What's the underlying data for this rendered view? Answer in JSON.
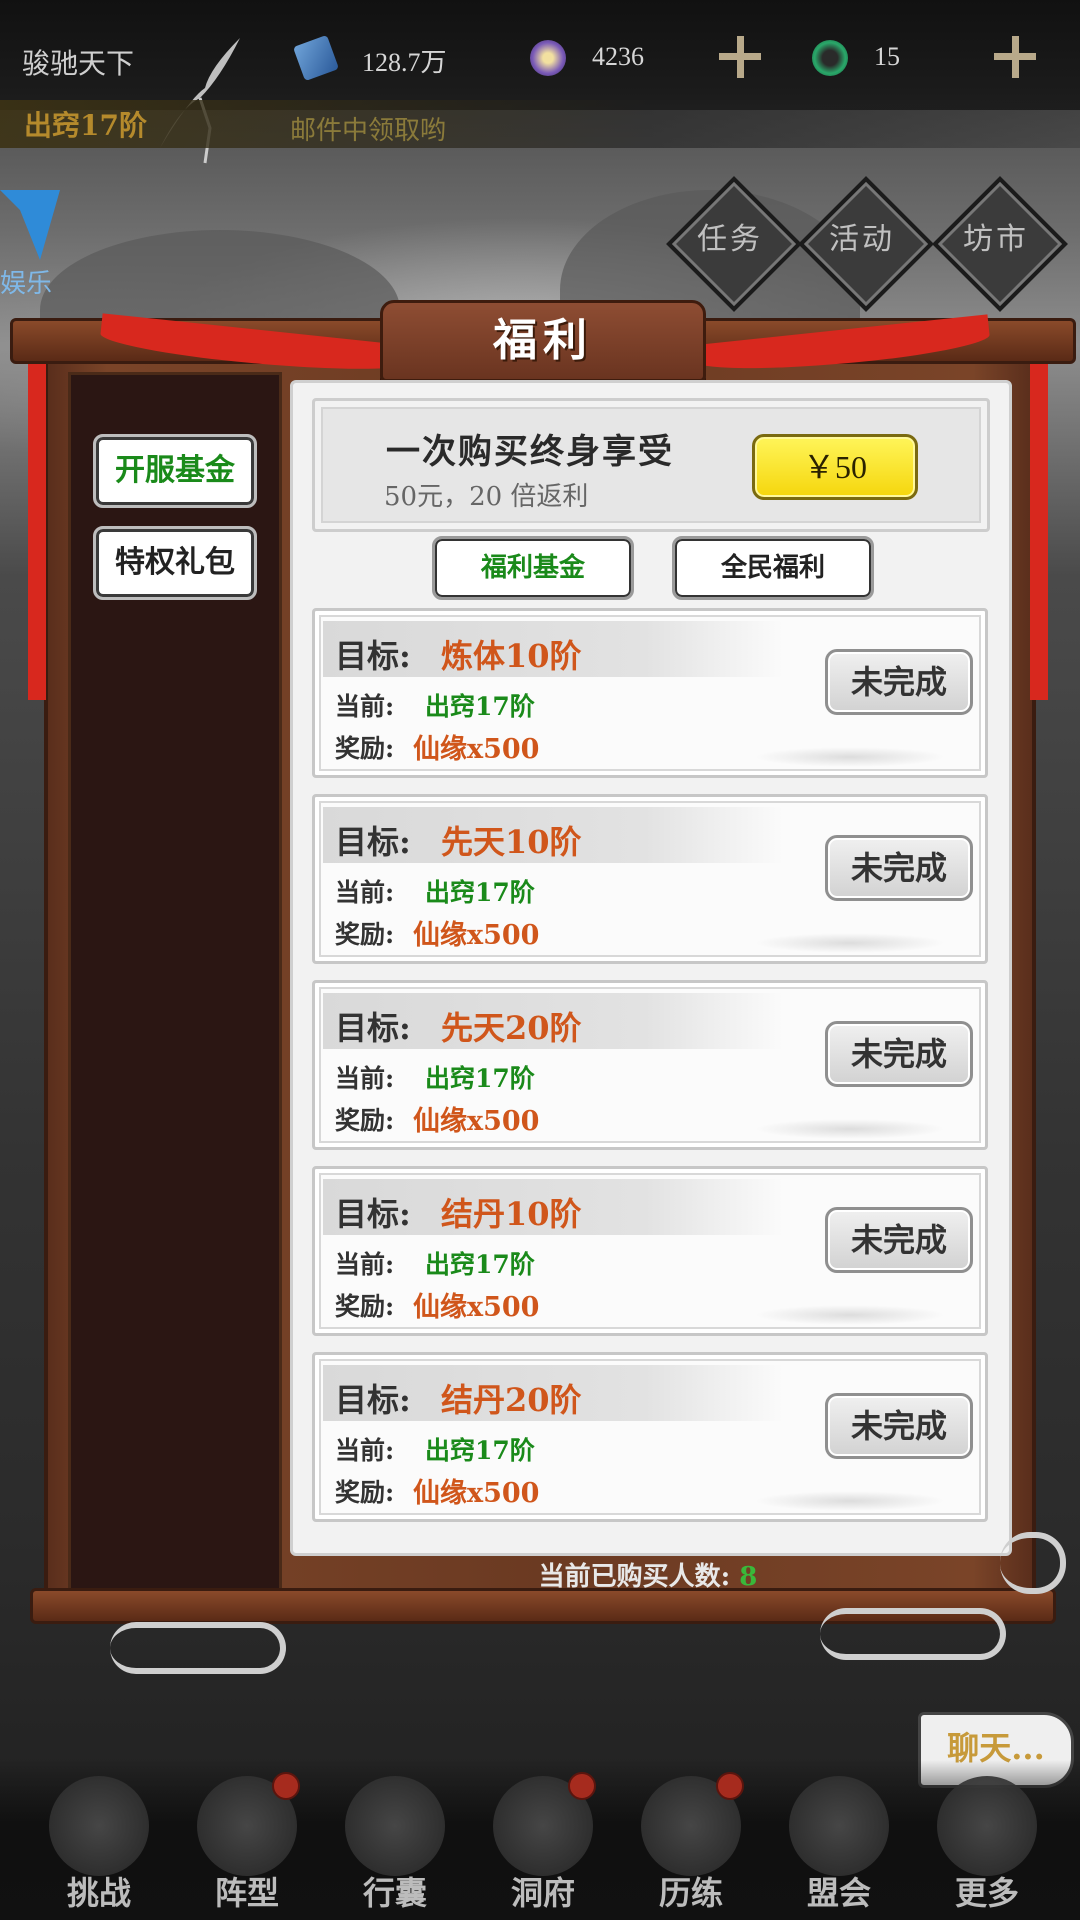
{
  "header": {
    "server_name": "骏驰天下",
    "resource_1": "128.7万",
    "resource_2": "4236",
    "resource_3": "15",
    "rank": "出窍17阶",
    "ticker": "邮件中领取哟"
  },
  "side_logo": "娱乐",
  "top_nav": [
    "任务",
    "活动",
    "坊市"
  ],
  "panel": {
    "title": "福利",
    "side_tabs": [
      "开服基金",
      "特权礼包"
    ],
    "banner": {
      "title": "一次购买终身享受",
      "subtitle": "50元，20 倍返利",
      "price": "￥50"
    },
    "sub_tabs": [
      "福利基金",
      "全民福利"
    ],
    "tasks": [
      {
        "goal_label": "目标:",
        "goal": "炼体10阶",
        "current_label": "当前:",
        "current": "出窍17阶",
        "reward_label": "奖励:",
        "reward": "仙缘x500",
        "status": "未完成"
      },
      {
        "goal_label": "目标:",
        "goal": "先天10阶",
        "current_label": "当前:",
        "current": "出窍17阶",
        "reward_label": "奖励:",
        "reward": "仙缘x500",
        "status": "未完成"
      },
      {
        "goal_label": "目标:",
        "goal": "先天20阶",
        "current_label": "当前:",
        "current": "出窍17阶",
        "reward_label": "奖励:",
        "reward": "仙缘x500",
        "status": "未完成"
      },
      {
        "goal_label": "目标:",
        "goal": "结丹10阶",
        "current_label": "当前:",
        "current": "出窍17阶",
        "reward_label": "奖励:",
        "reward": "仙缘x500",
        "status": "未完成"
      },
      {
        "goal_label": "目标:",
        "goal": "结丹20阶",
        "current_label": "当前:",
        "current": "出窍17阶",
        "reward_label": "奖励:",
        "reward": "仙缘x500",
        "status": "未完成"
      }
    ],
    "buyers_label": "当前已购买人数:",
    "buyers_count": "8"
  },
  "chat_label": "聊天...",
  "bottom_nav": [
    {
      "label": "挑战",
      "badge": false
    },
    {
      "label": "阵型",
      "badge": true
    },
    {
      "label": "行囊",
      "badge": false
    },
    {
      "label": "洞府",
      "badge": true
    },
    {
      "label": "历练",
      "badge": true
    },
    {
      "label": "盟会",
      "badge": false
    },
    {
      "label": "更多",
      "badge": false
    }
  ],
  "colors": {
    "goal_text": "#d0561b",
    "current_text": "#1a8a1a",
    "active_tab_text": "#1a8a1a",
    "price_button": "#f5d60c",
    "ribbon": "#d8281e"
  }
}
